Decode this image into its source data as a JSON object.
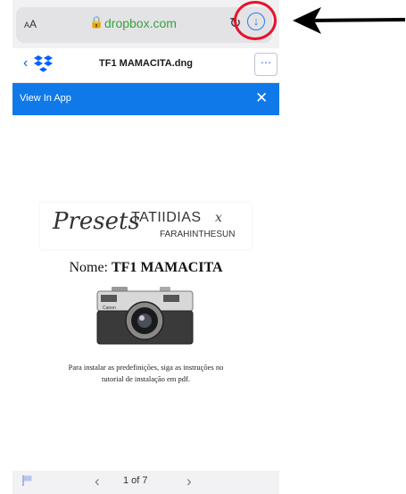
{
  "browser": {
    "text_size_label": "AA",
    "url": "dropbox.com",
    "lock_icon": "lock-icon",
    "reload_icon": "reload-icon",
    "download_icon": "download-icon"
  },
  "nav": {
    "back_icon": "back-chevron-icon",
    "logo": "dropbox-logo",
    "file_name": "TF1 MAMACITA.dng",
    "more_icon": "more-icon"
  },
  "banner": {
    "label": "View In App",
    "close_icon": "close-icon",
    "color": "#0f79ea"
  },
  "document": {
    "logo_script": "Presets",
    "logo_brand": "TATIIDIAS",
    "logo_x": "x",
    "logo_sub": "FARAHINTHESUN",
    "name_label": "Nome:",
    "name_value": "TF1 MAMACITA",
    "camera_icon": "camera-image",
    "instructions_line1": "Para instalar as predefinições, siga as instruções no",
    "instructions_line2": "tutorial de instalação em pdf."
  },
  "footer": {
    "flag_icon": "flag-icon",
    "prev_icon": "chevron-left-icon",
    "page_indicator": "1 of 7",
    "next_icon": "chevron-right-icon"
  },
  "annotation": {
    "circle_color": "#e8132b",
    "arrow_color": "#000000"
  }
}
